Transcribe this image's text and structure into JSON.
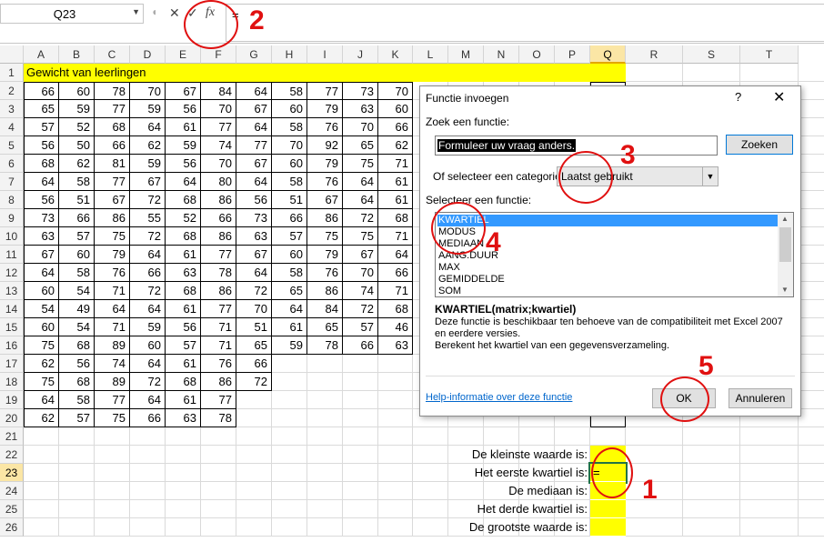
{
  "formula_bar": {
    "name_box": "Q23",
    "cancel_icon": "✕",
    "enter_icon": "✓",
    "fx_label": "fx",
    "formula": "="
  },
  "sheet": {
    "columns": [
      "A",
      "B",
      "C",
      "D",
      "E",
      "F",
      "G",
      "H",
      "I",
      "J",
      "K",
      "L",
      "M",
      "N",
      "O",
      "P",
      "Q",
      "R",
      "S",
      "T"
    ],
    "selected_column": "Q",
    "rows": [
      "1",
      "2",
      "3",
      "4",
      "5",
      "6",
      "7",
      "8",
      "9",
      "10",
      "11",
      "12",
      "13",
      "14",
      "15",
      "16",
      "17",
      "18",
      "19",
      "20",
      "21",
      "22",
      "23",
      "24",
      "25",
      "26"
    ],
    "selected_row": "23",
    "title": "Gewicht van leerlingen",
    "data": [
      [
        "66",
        "60",
        "78",
        "70",
        "67",
        "84",
        "64",
        "58",
        "77",
        "73",
        "70"
      ],
      [
        "65",
        "59",
        "77",
        "59",
        "56",
        "70",
        "67",
        "60",
        "79",
        "63",
        "60"
      ],
      [
        "57",
        "52",
        "68",
        "64",
        "61",
        "77",
        "64",
        "58",
        "76",
        "70",
        "66"
      ],
      [
        "56",
        "50",
        "66",
        "62",
        "59",
        "74",
        "77",
        "70",
        "92",
        "65",
        "62"
      ],
      [
        "68",
        "62",
        "81",
        "59",
        "56",
        "70",
        "67",
        "60",
        "79",
        "75",
        "71"
      ],
      [
        "64",
        "58",
        "77",
        "67",
        "64",
        "80",
        "64",
        "58",
        "76",
        "64",
        "61"
      ],
      [
        "56",
        "51",
        "67",
        "72",
        "68",
        "86",
        "56",
        "51",
        "67",
        "64",
        "61"
      ],
      [
        "73",
        "66",
        "86",
        "55",
        "52",
        "66",
        "73",
        "66",
        "86",
        "72",
        "68"
      ],
      [
        "63",
        "57",
        "75",
        "72",
        "68",
        "86",
        "63",
        "57",
        "75",
        "75",
        "71"
      ],
      [
        "67",
        "60",
        "79",
        "64",
        "61",
        "77",
        "67",
        "60",
        "79",
        "67",
        "64"
      ],
      [
        "64",
        "58",
        "76",
        "66",
        "63",
        "78",
        "64",
        "58",
        "76",
        "70",
        "66"
      ],
      [
        "60",
        "54",
        "71",
        "72",
        "68",
        "86",
        "72",
        "65",
        "86",
        "74",
        "71"
      ],
      [
        "54",
        "49",
        "64",
        "64",
        "61",
        "77",
        "70",
        "64",
        "84",
        "72",
        "68"
      ],
      [
        "60",
        "54",
        "71",
        "59",
        "56",
        "71",
        "51",
        "61",
        "65",
        "57",
        "46"
      ],
      [
        "75",
        "68",
        "89",
        "60",
        "57",
        "71",
        "65",
        "59",
        "78",
        "66",
        "63"
      ],
      [
        "62",
        "56",
        "74",
        "64",
        "61",
        "76",
        "66"
      ],
      [
        "75",
        "68",
        "89",
        "72",
        "68",
        "86",
        "72"
      ],
      [
        "64",
        "58",
        "77",
        "64",
        "61",
        "77"
      ],
      [
        "62",
        "57",
        "75",
        "66",
        "63",
        "78"
      ]
    ],
    "labels": [
      {
        "row": "22",
        "text": "De kleinste waarde is:"
      },
      {
        "row": "23",
        "text": "Het eerste kwartiel is:",
        "value": "="
      },
      {
        "row": "24",
        "text": "De mediaan is:"
      },
      {
        "row": "25",
        "text": "Het derde kwartiel is:"
      },
      {
        "row": "26",
        "text": "De grootste waarde is:"
      }
    ]
  },
  "dialog": {
    "title": "Functie invoegen",
    "help_icon": "?",
    "close_icon": "✕",
    "search_label": "Zoek een functie:",
    "search_value": "Formuleer uw vraag anders.",
    "search_button": "Zoeken",
    "category_label": "Of selecteer een categorie:",
    "category_value": "Laatst gebruikt",
    "function_label": "Selecteer een functie:",
    "functions": [
      "KWARTIEL",
      "MODUS",
      "MEDIAAN",
      "AANG.DUUR",
      "MAX",
      "GEMIDDELDE",
      "SOM"
    ],
    "selected_function": "KWARTIEL",
    "signature": "KWARTIEL(matrix;kwartiel)",
    "description": "Deze functie is beschikbaar ten behoeve van de compatibiliteit met Excel 2007 en eerdere versies.",
    "description2": "Berekent het kwartiel van een gegevensverzameling.",
    "help_link": "Help-informatie over deze functie",
    "ok_button": "OK",
    "cancel_button": "Annuleren"
  },
  "annotations": [
    "1",
    "2",
    "3",
    "4",
    "5"
  ],
  "colors": {
    "highlight": "#ffff00",
    "annotation": "#e01010",
    "selection": "#3399ff"
  }
}
